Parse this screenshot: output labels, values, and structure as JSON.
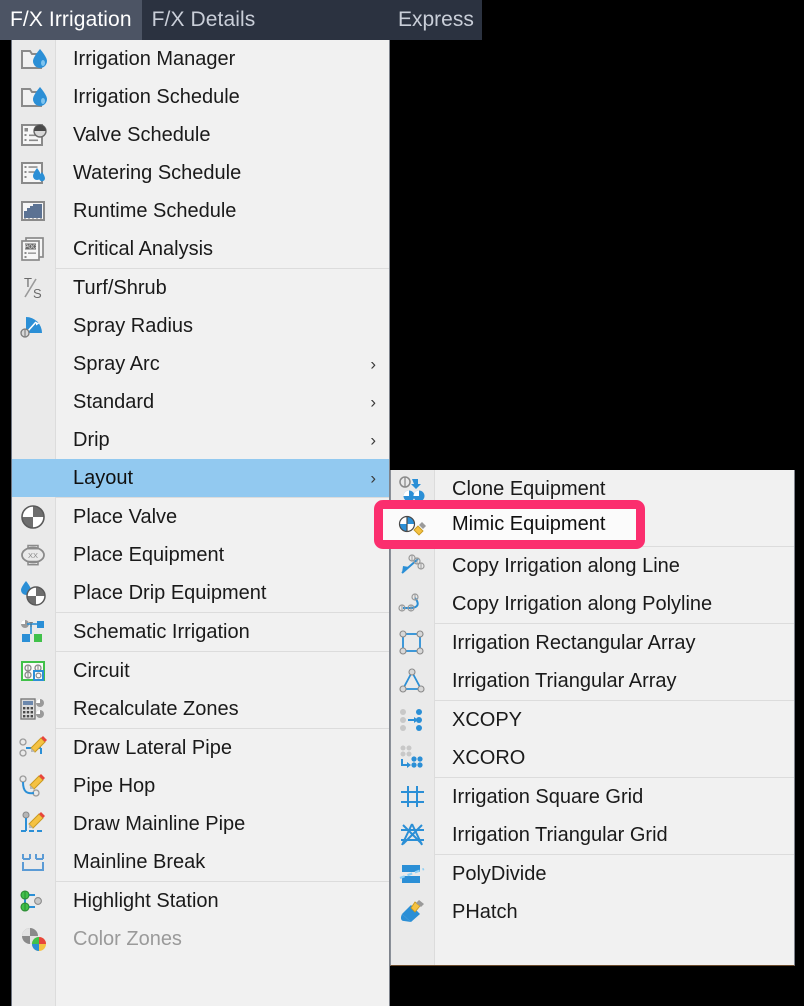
{
  "tabs": [
    {
      "label": "F/X Irrigation",
      "active": true
    },
    {
      "label": "F/X Details",
      "active": false
    },
    {
      "label": "Express",
      "active": false
    }
  ],
  "colors": {
    "tabbar_bg": "#2b3240",
    "tab_active_bg": "#4c5464",
    "menu_bg": "#f1f1f1",
    "icon_col_bg": "#eaeaea",
    "selection_blue": "#92c9f0",
    "annotation_pink": "#fb2e6e",
    "icon_blue": "#2b8fd6",
    "icon_gray": "#808080",
    "icon_green": "#3fb53f",
    "icon_yellow": "#f5c242"
  },
  "main_menu": {
    "groups": [
      {
        "items": [
          {
            "label": "Irrigation Manager",
            "icon": "folder-water-icon",
            "submenu": false,
            "disabled": false,
            "selected": false
          },
          {
            "label": "Irrigation Schedule",
            "icon": "folder-water-icon",
            "submenu": false,
            "disabled": false,
            "selected": false
          },
          {
            "label": "Valve Schedule",
            "icon": "list-pie-icon",
            "submenu": false,
            "disabled": false,
            "selected": false
          },
          {
            "label": "Watering Schedule",
            "icon": "list-droplets-icon",
            "submenu": false,
            "disabled": false,
            "selected": false
          },
          {
            "label": "Runtime Schedule",
            "icon": "runtime-chart-icon",
            "submenu": false,
            "disabled": false,
            "selected": false
          },
          {
            "label": "Critical Analysis",
            "icon": "poc-document-icon",
            "submenu": false,
            "disabled": false,
            "selected": false
          }
        ]
      },
      {
        "items": [
          {
            "label": "Turf/Shrub",
            "icon": "turf-shrub-icon",
            "submenu": false,
            "disabled": false,
            "selected": false
          },
          {
            "label": "Spray Radius",
            "icon": "spray-radius-icon",
            "submenu": false,
            "disabled": false,
            "selected": false
          },
          {
            "label": "Spray Arc",
            "icon": "none",
            "submenu": true,
            "disabled": false,
            "selected": false
          },
          {
            "label": "Standard",
            "icon": "none",
            "submenu": true,
            "disabled": false,
            "selected": false
          },
          {
            "label": "Drip",
            "icon": "none",
            "submenu": true,
            "disabled": false,
            "selected": false
          },
          {
            "label": "Layout",
            "icon": "none",
            "submenu": true,
            "disabled": false,
            "selected": true
          }
        ]
      },
      {
        "items": [
          {
            "label": "Place Valve",
            "icon": "valve-icon",
            "submenu": false,
            "disabled": false,
            "selected": false
          },
          {
            "label": "Place Equipment",
            "icon": "equipment-xx-icon",
            "submenu": false,
            "disabled": false,
            "selected": false
          },
          {
            "label": "Place Drip Equipment",
            "icon": "drip-valve-icon",
            "submenu": false,
            "disabled": false,
            "selected": false
          }
        ]
      },
      {
        "items": [
          {
            "label": "Schematic Irrigation",
            "icon": "schematic-icon",
            "submenu": false,
            "disabled": false,
            "selected": false
          }
        ]
      },
      {
        "items": [
          {
            "label": "Circuit",
            "icon": "circuit-icon",
            "submenu": false,
            "disabled": false,
            "selected": false
          },
          {
            "label": "Recalculate Zones",
            "icon": "calculator-icon",
            "submenu": false,
            "disabled": false,
            "selected": false
          }
        ]
      },
      {
        "items": [
          {
            "label": "Draw Lateral Pipe",
            "icon": "lateral-pipe-icon",
            "submenu": false,
            "disabled": false,
            "selected": false
          },
          {
            "label": "Pipe Hop",
            "icon": "pipe-hop-icon",
            "submenu": false,
            "disabled": false,
            "selected": false
          },
          {
            "label": "Draw Mainline Pipe",
            "icon": "mainline-pipe-icon",
            "submenu": false,
            "disabled": false,
            "selected": false
          },
          {
            "label": "Mainline Break",
            "icon": "mainline-break-icon",
            "submenu": false,
            "disabled": false,
            "selected": false
          }
        ]
      },
      {
        "items": [
          {
            "label": "Highlight Station",
            "icon": "highlight-station-icon",
            "submenu": false,
            "disabled": false,
            "selected": false
          },
          {
            "label": "Color Zones",
            "icon": "color-zones-icon",
            "submenu": false,
            "disabled": true,
            "selected": false
          }
        ]
      }
    ]
  },
  "submenu": {
    "parent": "Layout",
    "groups": [
      {
        "items": [
          {
            "label": "Clone Equipment",
            "icon": "clone-equipment-icon",
            "highlighted": false
          },
          {
            "label": "Mimic Equipment",
            "icon": "mimic-equipment-icon",
            "highlighted": true
          }
        ]
      },
      {
        "items": [
          {
            "label": "Copy Irrigation along Line",
            "icon": "copy-along-line-icon",
            "highlighted": false
          },
          {
            "label": "Copy Irrigation along Polyline",
            "icon": "copy-along-polyline-icon",
            "highlighted": false
          }
        ]
      },
      {
        "items": [
          {
            "label": "Irrigation Rectangular Array",
            "icon": "rect-array-icon",
            "highlighted": false
          },
          {
            "label": "Irrigation Triangular Array",
            "icon": "tri-array-icon",
            "highlighted": false
          }
        ]
      },
      {
        "items": [
          {
            "label": "XCOPY",
            "icon": "xcopy-icon",
            "highlighted": false
          },
          {
            "label": "XCORO",
            "icon": "xcoro-icon",
            "highlighted": false
          }
        ]
      },
      {
        "items": [
          {
            "label": "Irrigation Square Grid",
            "icon": "square-grid-icon",
            "highlighted": false
          },
          {
            "label": "Irrigation Triangular Grid",
            "icon": "tri-grid-icon",
            "highlighted": false
          }
        ]
      },
      {
        "items": [
          {
            "label": "PolyDivide",
            "icon": "polydivide-icon",
            "highlighted": false
          },
          {
            "label": "PHatch",
            "icon": "phatch-icon",
            "highlighted": false
          }
        ]
      }
    ]
  },
  "annotation": {
    "target_label": "Mimic Equipment",
    "shape": "rounded-rectangle",
    "color": "#fb2e6e"
  },
  "arrow_glyph": "›"
}
